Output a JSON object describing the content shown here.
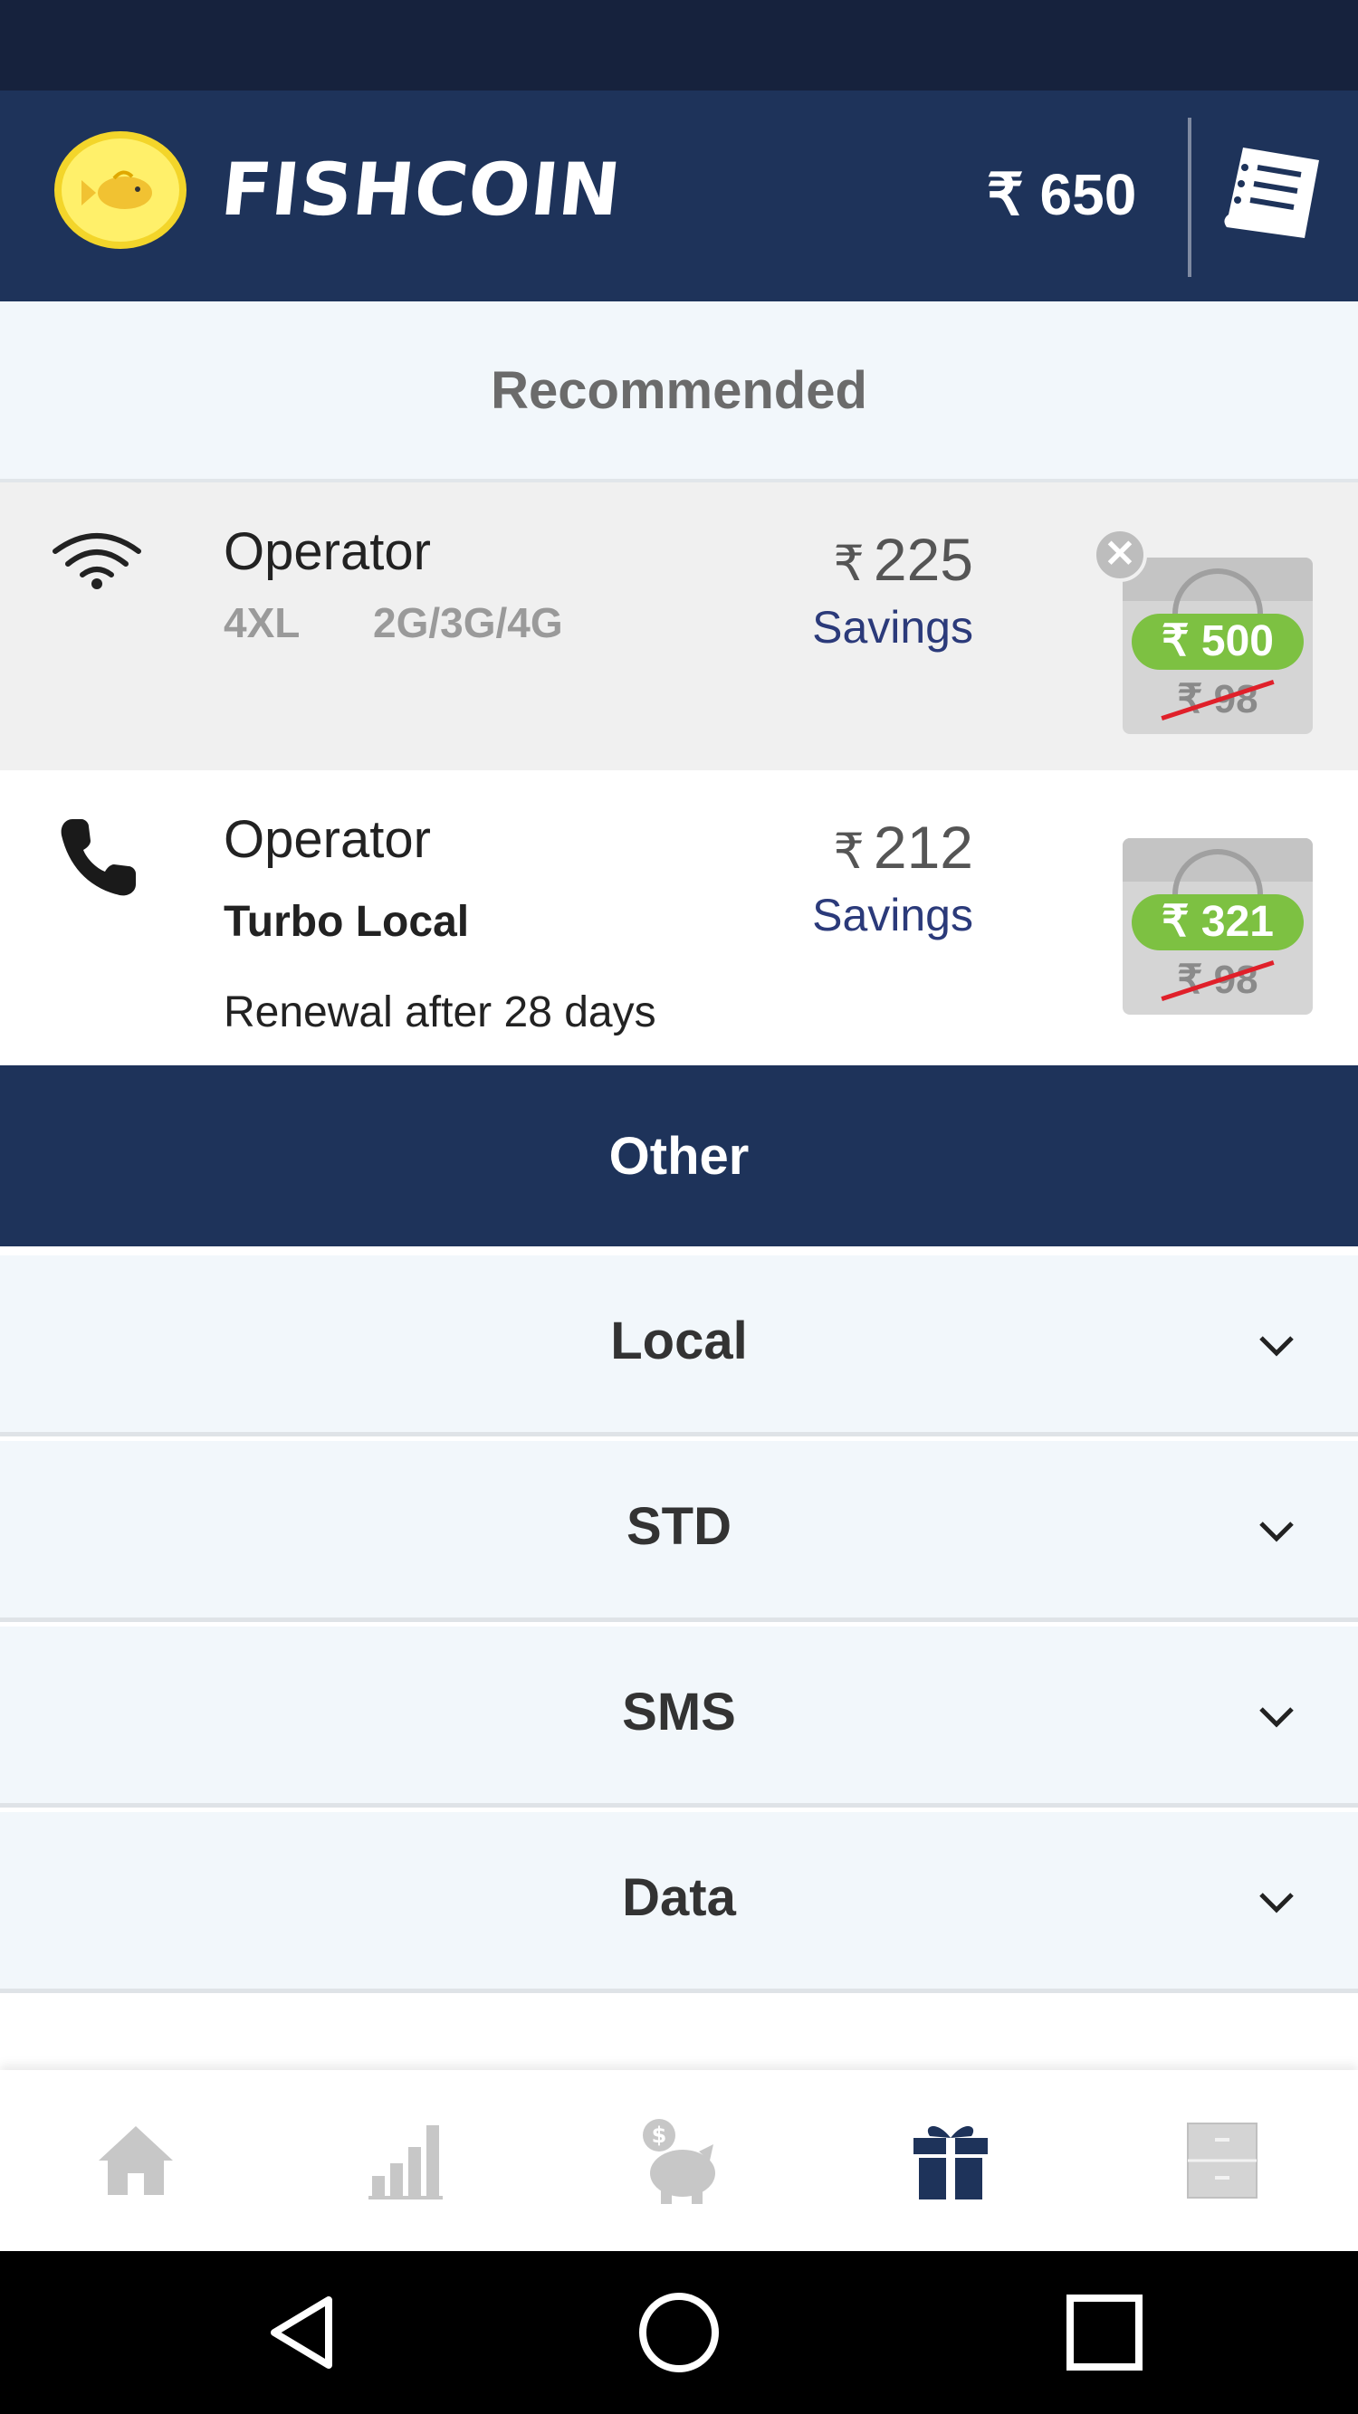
{
  "app": {
    "brand_name": "FISHCOIN",
    "balance": "₹ 650",
    "logo_icon": "fish-coin-logo-icon",
    "receipt_icon": "receipt-icon",
    "colors": {
      "primary": "#1e335a",
      "status_bar": "#16223d",
      "accent_green": "#7dc142",
      "strike_red": "#e0202a"
    }
  },
  "recommended": {
    "header": "Recommended",
    "plans": [
      {
        "icon": "wifi-icon",
        "operator": "Operator",
        "pack": "4XL",
        "network": "2G/3G/4G",
        "savings_amount": "225",
        "currency": "₹",
        "savings_label": "Savings",
        "price": "₹ 500",
        "old_price": "₹ 98",
        "dismissible": true
      },
      {
        "icon": "phone-icon",
        "operator": "Operator",
        "plan_name": "Turbo Local",
        "renewal": "Renewal after 28 days",
        "savings_amount": "212",
        "currency": "₹",
        "savings_label": "Savings",
        "price": "₹ 321",
        "old_price": "₹ 98"
      }
    ]
  },
  "other": {
    "header": "Other",
    "categories": [
      "Local",
      "STD",
      "SMS",
      "Data"
    ]
  },
  "tabbar": {
    "tabs": [
      "home-icon",
      "stats-icon",
      "piggy-bank-icon",
      "gift-icon",
      "cabinet-icon"
    ],
    "active": "gift-icon"
  }
}
